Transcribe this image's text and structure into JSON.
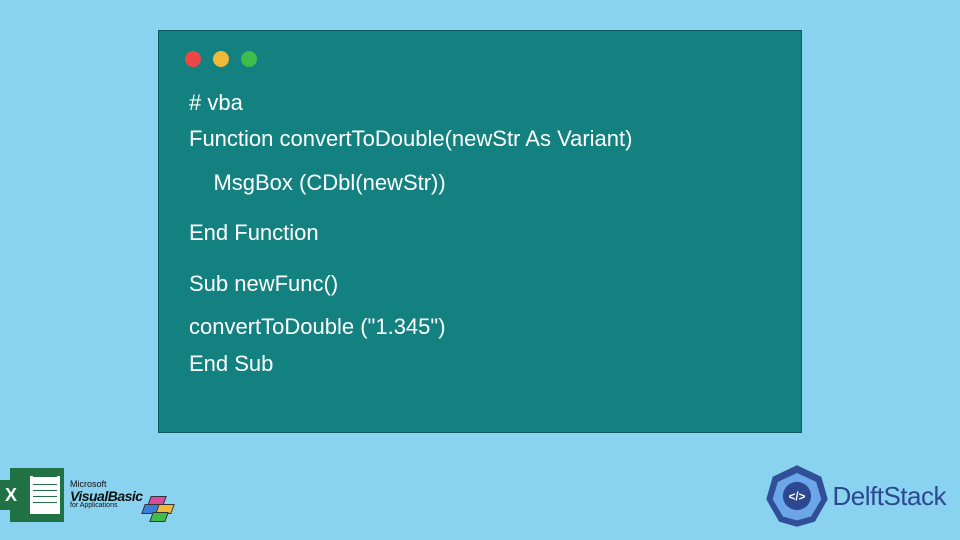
{
  "code": {
    "line1": "# vba",
    "line2": "Function convertToDouble(newStr As Variant)",
    "line3": "    MsgBox (CDbl(newStr))",
    "line4": "End Function",
    "line5": "Sub newFunc()",
    "line6": "convertToDouble (\"1.345\")",
    "line7": "End Sub"
  },
  "branding": {
    "excel_x": "X",
    "ms": "Microsoft",
    "vb": "VisualBasic",
    "app": "for Applications"
  },
  "delft": {
    "text": "DelftStack",
    "glyph": "</>"
  }
}
